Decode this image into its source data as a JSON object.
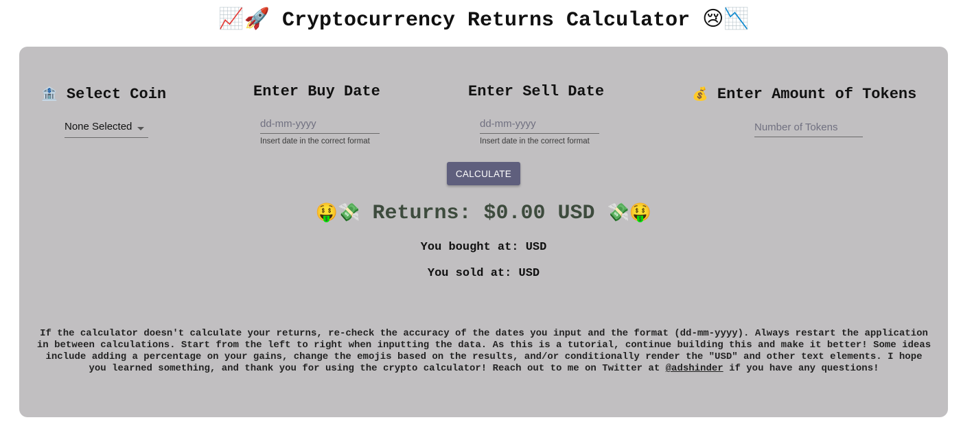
{
  "page": {
    "title": "Cryptocurrency Returns Calculator",
    "title_emoji_left": "📈🚀",
    "title_emoji_right": "😢📉"
  },
  "coin": {
    "heading_emoji": "🏦",
    "heading": "Select Coin",
    "selected": "None Selected"
  },
  "buy_date": {
    "heading": "Enter Buy Date",
    "placeholder": "dd-mm-yyyy",
    "helper": "Insert date in the correct format"
  },
  "sell_date": {
    "heading": "Enter Sell Date",
    "placeholder": "dd-mm-yyyy",
    "helper": "Insert date in the correct format"
  },
  "tokens": {
    "heading_emoji": "💰",
    "heading": "Enter Amount of Tokens",
    "placeholder": "Number of Tokens"
  },
  "calculate_label": "CALCULATE",
  "results": {
    "emoji_left": "🤑💸",
    "returns_text": "Returns: $0.00 USD",
    "emoji_right": "💸🤑",
    "bought_text": "You bought at: USD",
    "sold_text": "You sold at: USD"
  },
  "footer": {
    "text": "If the calculator doesn't calculate your returns, re-check the accuracy of the dates you input and the format (dd-mm-yyyy). Always restart the application in between calculations. Start from the left to right when inputting the data. As this is a tutorial, continue building this and make it better! Some ideas include adding a percentage on your gains, change the emojis based on the results, and/or conditionally render the \"USD\" and other text elements. I hope you learned something, and thank you for using the crypto calculator! Reach out to me on Twitter at",
    "link_text": "@adshinder",
    "text_end": "if you have any questions!"
  }
}
